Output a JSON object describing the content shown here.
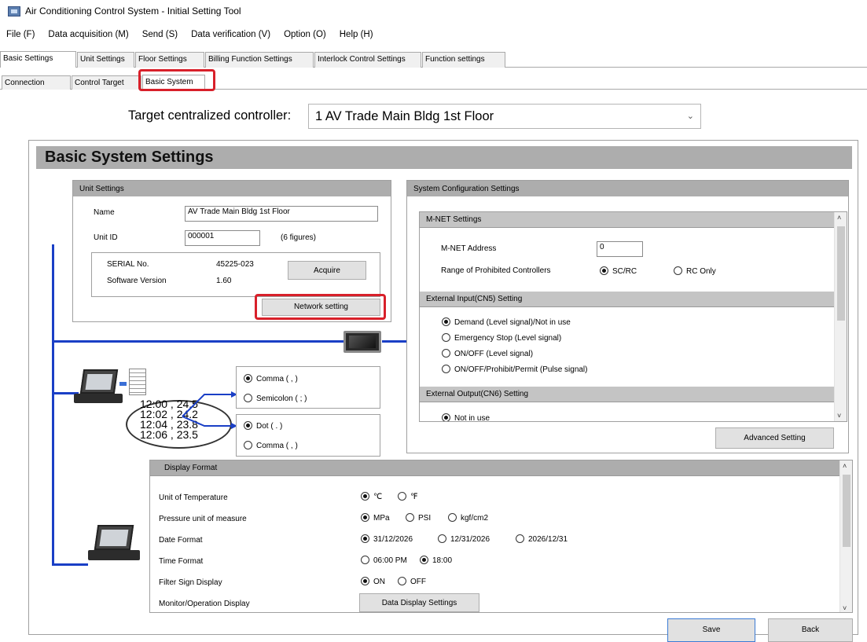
{
  "window": {
    "title": "Air Conditioning Control System - Initial Setting Tool"
  },
  "menu": [
    "File (F)",
    "Data acquisition (M)",
    "Send (S)",
    "Data verification (V)",
    "Option (O)",
    "Help (H)"
  ],
  "tabs": [
    "Basic Settings",
    "Unit Settings",
    "Floor Settings",
    "Billing Function Settings",
    "Interlock Control Settings",
    "Function settings"
  ],
  "subtabs": [
    "Connection",
    "Control Target",
    "Basic System"
  ],
  "target": {
    "label": "Target centralized controller:",
    "value": "1  AV Trade Main Bldg 1st Floor"
  },
  "section_title": "Basic System Settings",
  "unit_settings": {
    "title": "Unit Settings",
    "name_label": "Name",
    "name_value": "AV Trade Main Bldg 1st Floor",
    "unitid_label": "Unit ID",
    "unitid_value": "000001",
    "unitid_hint": "(6 figures)",
    "serial_label": "SERIAL No.",
    "serial_value": "45225-023",
    "version_label": "Software Version",
    "version_value": "1.60",
    "acquire": "Acquire",
    "network": "Network setting"
  },
  "csv": {
    "lines": [
      "12:00 , 24.5",
      "12:02 , 24.2",
      "12:04 , 23.8",
      "12:06 , 23.5"
    ],
    "sep_opts": [
      "Comma ( , )",
      "Semicolon ( ; )"
    ],
    "dec_opts": [
      "Dot ( . )",
      "Comma ( , )"
    ]
  },
  "system_config": {
    "title": "System Configuration Settings",
    "mnet_title": "M-NET Settings",
    "mnet_addr_label": "M-NET Address",
    "mnet_addr_value": "0",
    "range_label": "Range of Prohibited Controllers",
    "range_opts": [
      "SC/RC",
      "RC Only"
    ],
    "cn5_title": "External Input(CN5) Setting",
    "cn5_opts": [
      "Demand (Level signal)/Not in use",
      "Emergency Stop (Level signal)",
      "ON/OFF (Level signal)",
      "ON/OFF/Prohibit/Permit (Pulse signal)"
    ],
    "cn6_title": "External Output(CN6) Setting",
    "cn6_opt": "Not in use",
    "advanced": "Advanced Setting"
  },
  "display_format": {
    "title": "Display Format",
    "temp_label": "Unit of Temperature",
    "temp_opts": [
      "℃",
      "℉"
    ],
    "pressure_label": "Pressure unit of measure",
    "pressure_opts": [
      "MPa",
      "PSI",
      "kgf/cm2"
    ],
    "date_label": "Date Format",
    "date_opts": [
      "31/12/2026",
      "12/31/2026",
      "2026/12/31"
    ],
    "time_label": "Time Format",
    "time_opts": [
      "06:00 PM",
      "18:00"
    ],
    "filter_label": "Filter Sign Display",
    "filter_opts": [
      "ON",
      "OFF"
    ],
    "monitor_label": "Monitor/Operation Display",
    "monitor_btn": "Data Display Settings"
  },
  "footer": {
    "save": "Save",
    "back": "Back"
  }
}
